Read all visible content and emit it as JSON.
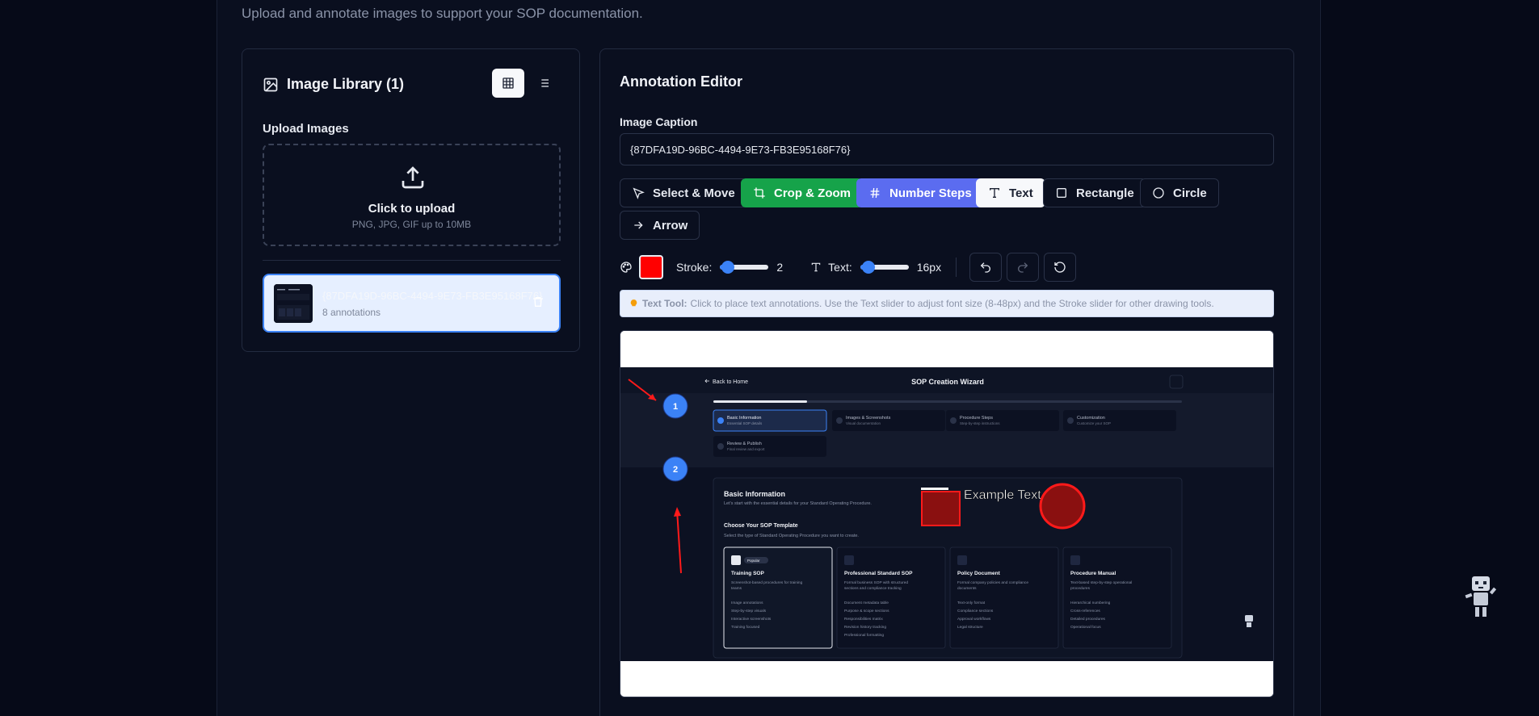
{
  "page": {
    "subtitle": "Upload and annotate images to support your SOP documentation."
  },
  "library": {
    "title": "Image Library (1)",
    "upload_label": "Upload Images",
    "dropzone_title": "Click to upload",
    "dropzone_hint": "PNG, JPG, GIF up to 10MB",
    "item": {
      "name": "{87DFA19D-96BC-4494-9E73-FB3E95168F76}",
      "annotations": "8 annotations"
    }
  },
  "editor": {
    "title": "Annotation Editor",
    "caption_label": "Image Caption",
    "caption_value": "{87DFA19D-96BC-4494-9E73-FB3E95168F76}",
    "tools": {
      "select": "Select & Move",
      "crop": "Crop & Zoom",
      "number": "Number Steps",
      "text": "Text",
      "rect": "Rectangle",
      "circle": "Circle",
      "arrow": "Arrow"
    },
    "active_tool": "Text",
    "stroke_label": "Stroke:",
    "stroke_value": "2",
    "text_label": "Text:",
    "text_value": "16px",
    "color": "#ff0000",
    "tip_title": "Text Tool:",
    "tip_body": "Click to place text annotations. Use the Text slider to adjust font size (8-48px) and the Stroke slider for other drawing tools."
  },
  "preview": {
    "back": "Back to Home",
    "wizard_title": "SOP Creation Wizard",
    "steps": [
      {
        "n": "1",
        "title": "Basic Information",
        "sub": "Essential SOP details"
      },
      {
        "n": "2",
        "title": "Images & Screenshots",
        "sub": "Visual documentation"
      },
      {
        "n": "3",
        "title": "Procedure Steps",
        "sub": "Step-by-step instructions"
      },
      {
        "n": "4",
        "title": "Customization",
        "sub": "Customize your SOP"
      },
      {
        "n": "5",
        "title": "Review & Publish",
        "sub": "Final review and export"
      }
    ],
    "section_title": "Basic Information",
    "section_sub": "Let's start with the essential details for your Standard Operating Procedure.",
    "choose_title": "Choose Your SOP Template",
    "choose_sub": "Select the type of Standard Operating Procedure you want to create.",
    "popular": "Popular",
    "templates": [
      {
        "title": "Training SOP",
        "desc1": "Screenshot-based procedures for training",
        "desc2": "teams",
        "items": [
          "Image annotations",
          "Step-by-step visuals",
          "Interactive screenshots",
          "Training focused"
        ]
      },
      {
        "title": "Professional Standard SOP",
        "desc1": "Formal business SOP with structured",
        "desc2": "sections and compliance tracking",
        "items": [
          "Document metadata table",
          "Purpose & scope sections",
          "Responsibilities matrix",
          "Revision history tracking",
          "Professional formatting"
        ]
      },
      {
        "title": "Policy Document",
        "desc1": "Formal company policies and compliance",
        "desc2": "documents",
        "items": [
          "Text-only format",
          "Compliance sections",
          "Approval workflows",
          "Legal structure"
        ]
      },
      {
        "title": "Procedure Manual",
        "desc1": "Text-based step-by-step operational",
        "desc2": "procedures",
        "items": [
          "Hierarchical numbering",
          "Cross-references",
          "Detailed procedures",
          "Operational focus"
        ]
      }
    ],
    "annotation_text": "Example Text",
    "marker1": "1",
    "marker2": "2"
  }
}
